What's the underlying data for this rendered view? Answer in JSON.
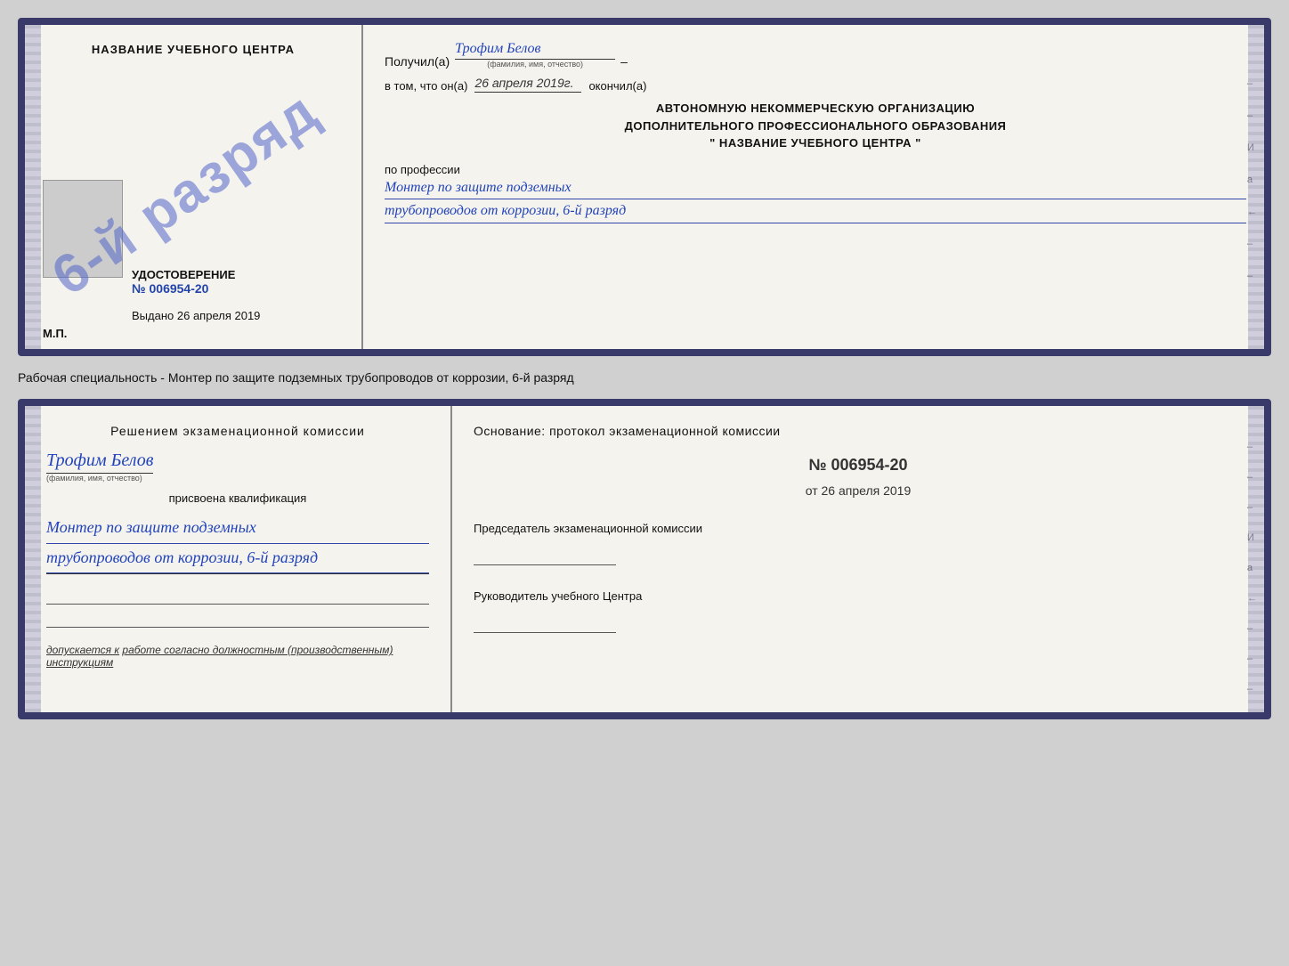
{
  "top_cert": {
    "left": {
      "org_name": "НАЗВАНИЕ УЧЕБНОГО ЦЕНТРА",
      "stamp_line1": "6-й",
      "stamp_line2": "разряд",
      "udost_title": "УДОСТОВЕРЕНИЕ",
      "udost_number": "№ 006954-20",
      "vydano_label": "Выдано",
      "vydano_date": "26 апреля 2019",
      "mp_label": "М.П."
    },
    "right": {
      "poluchil_label": "Получил(а)",
      "poluchil_name": "Трофим Белов",
      "fio_hint": "(фамилия, имя, отчество)",
      "dash": "–",
      "vtom_label": "в том, что он(а)",
      "vtom_date": "26 апреля 2019г.",
      "okonchil_label": "окончил(а)",
      "org_line1": "АВТОНОМНУЮ НЕКОММЕРЧЕСКУЮ ОРГАНИЗАЦИЮ",
      "org_line2": "ДОПОЛНИТЕЛЬНОГО ПРОФЕССИОНАЛЬНОГО ОБРАЗОВАНИЯ",
      "org_line3": "\" НАЗВАНИЕ УЧЕБНОГО ЦЕНТРА \"",
      "po_professii": "по профессии",
      "prof_name_line1": "Монтер по защите подземных",
      "prof_name_line2": "трубопроводов от коррозии, 6-й разряд",
      "side_marks": [
        "–",
        "–",
        "И",
        "а",
        "←",
        "–",
        "–"
      ]
    }
  },
  "separator": {
    "text": "Рабочая специальность - Монтер по защите подземных трубопроводов от коррозии, 6-й разряд"
  },
  "bottom_cert": {
    "left": {
      "reshen_title": "Решением экзаменационной комиссии",
      "fio_name": "Трофим Белов",
      "fio_hint": "(фамилия, имя, отчество)",
      "prisvoena": "присвоена квалификация",
      "kvalif_line1": "Монтер по защите подземных",
      "kvalif_line2": "трубопроводов от коррозии, 6-й разряд",
      "dopuskaetsya_prefix": "допускается к",
      "dopuskaetsya_text": "работе согласно должностным (производственным) инструкциям"
    },
    "right": {
      "osnov_title": "Основание: протокол экзаменационной комиссии",
      "protocol_number": "№ 006954-20",
      "ot_label": "от",
      "protocol_date": "26 апреля 2019",
      "chairman_title": "Председатель экзаменационной комиссии",
      "rukv_title": "Руководитель учебного Центра",
      "side_marks": [
        "–",
        "–",
        "–",
        "И",
        "а",
        "←",
        "–",
        "–",
        "–"
      ]
    }
  }
}
